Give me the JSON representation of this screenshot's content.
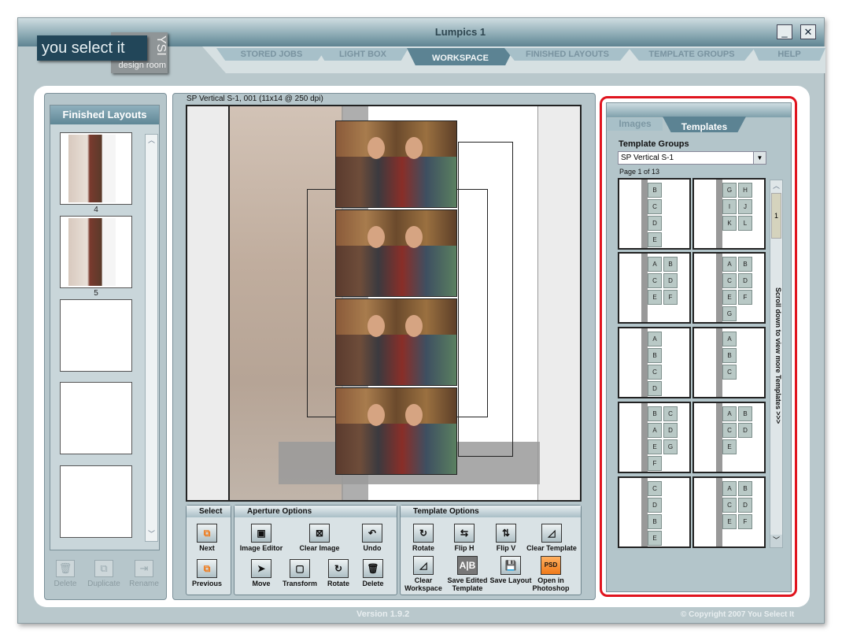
{
  "window": {
    "title": "Lumpics 1",
    "minimize": "_",
    "close": "✕"
  },
  "logo": {
    "text": "you select it",
    "mark": "YSI",
    "sub": "design room"
  },
  "nav": {
    "tabs": [
      {
        "label": "STORED JOBS"
      },
      {
        "label": "LIGHT BOX"
      },
      {
        "label": "WORKSPACE",
        "active": true
      },
      {
        "label": "FINISHED LAYOUTS"
      },
      {
        "label": "TEMPLATE GROUPS"
      },
      {
        "label": "HELP"
      }
    ]
  },
  "left": {
    "title": "Finished Layouts",
    "thumbs": [
      {
        "label": "4"
      },
      {
        "label": "5"
      },
      {
        "label": ""
      },
      {
        "label": ""
      },
      {
        "label": ""
      }
    ],
    "buttons": [
      {
        "label": "Delete",
        "icon": "trash-icon"
      },
      {
        "label": "Duplicate",
        "icon": "duplicate-icon"
      },
      {
        "label": "Rename",
        "icon": "rename-icon"
      }
    ]
  },
  "workspace": {
    "caption": "SP Vertical S-1, 001 (11x14 @ 250 dpi)"
  },
  "select": {
    "title": "Select",
    "next": "Next",
    "previous": "Previous"
  },
  "aperture": {
    "title": "Aperture Options",
    "items": [
      {
        "label": "Image Editor",
        "icon": "image-editor-icon"
      },
      {
        "label": "Clear Image",
        "icon": "clear-image-icon"
      },
      {
        "label": "Undo",
        "icon": "undo-icon"
      },
      {
        "label": "Move",
        "icon": "move-cursor-icon"
      },
      {
        "label": "Transform",
        "icon": "transform-icon"
      },
      {
        "label": "Rotate",
        "icon": "rotate-icon"
      },
      {
        "label": "Delete",
        "icon": "trash-icon"
      }
    ]
  },
  "template_options": {
    "title": "Template Options",
    "items": [
      {
        "label": "Rotate"
      },
      {
        "label": "Flip H"
      },
      {
        "label": "Flip V"
      },
      {
        "label": "Clear Template"
      },
      {
        "label": "Clear Workspace"
      },
      {
        "label": "Save Edited Template"
      },
      {
        "label": "Save Layout"
      },
      {
        "label": "Open in Photoshop"
      }
    ]
  },
  "right": {
    "tabs": [
      {
        "label": "Images"
      },
      {
        "label": "Templates",
        "active": true
      }
    ],
    "groups_label": "Template Groups",
    "group_value": "SP Vertical S-1",
    "page": "Page 1 of 13",
    "scroll_page": "1",
    "hint": "Scroll down to view more Templates >>>",
    "templates": [
      [
        "B",
        "C",
        "D",
        "E"
      ],
      [
        "G",
        "H",
        "I",
        "J",
        "K",
        "L"
      ],
      [
        "A",
        "B",
        "C",
        "D",
        "E",
        "F"
      ],
      [
        "A",
        "B",
        "C",
        "D",
        "E",
        "F",
        "G"
      ],
      [
        "A",
        "B",
        "C",
        "D"
      ],
      [
        "A",
        "B",
        "C"
      ],
      [
        "B",
        "C",
        "A",
        "D",
        "E",
        "G",
        "F"
      ],
      [
        "A",
        "B",
        "C",
        "D",
        "E"
      ],
      [
        "C",
        "D",
        "B",
        "E"
      ],
      [
        "A",
        "B",
        "C",
        "D",
        "E",
        "F"
      ]
    ]
  },
  "footer": {
    "version": "Version 1.9.2",
    "copyright": "© Copyright 2007 You Select It"
  },
  "colors": {
    "highlight": "#e0141e",
    "header": "#5c8393",
    "photoshop": "#f58a2a"
  }
}
